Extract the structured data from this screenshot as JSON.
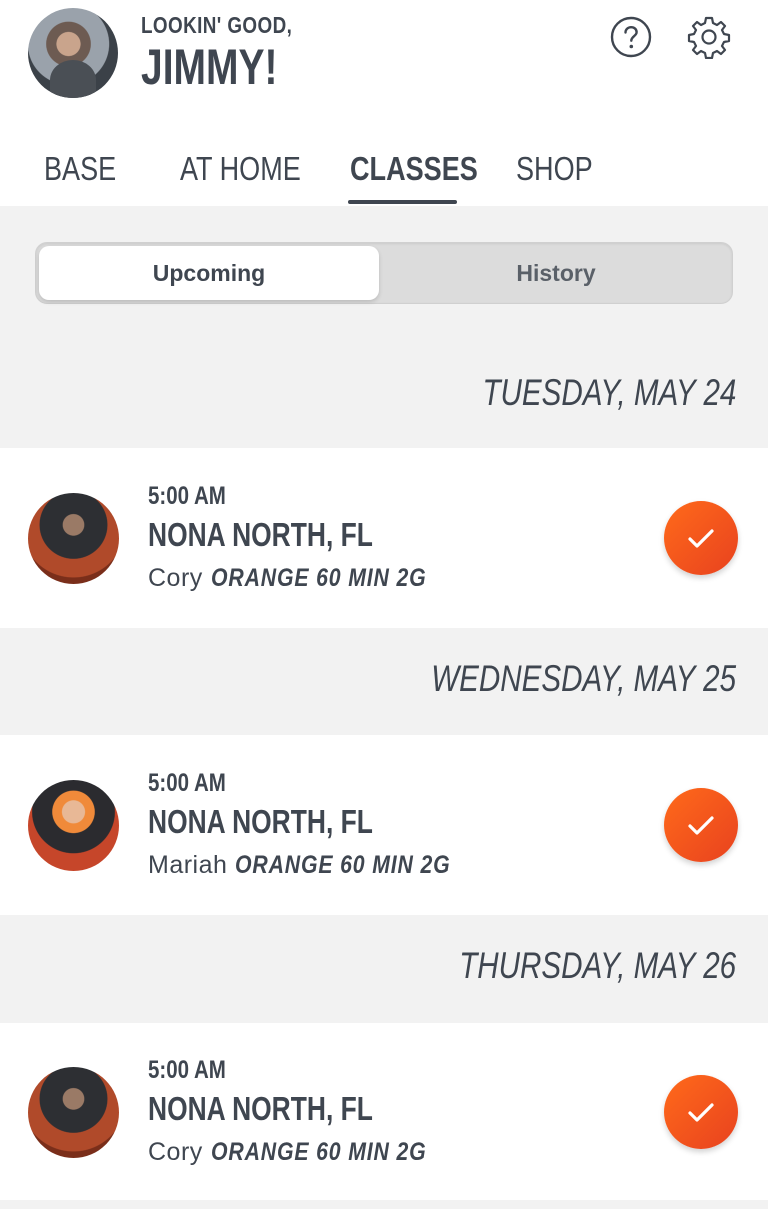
{
  "header": {
    "greeting_line1": "LOOKIN' GOOD,",
    "greeting_line2": "JIMMY!",
    "help_icon": "help-circle-icon",
    "settings_icon": "gear-icon"
  },
  "tabs": [
    {
      "label": "BASE",
      "active": false
    },
    {
      "label": "AT HOME",
      "active": false
    },
    {
      "label": "CLASSES",
      "active": true
    },
    {
      "label": "SHOP",
      "active": false
    }
  ],
  "segment": {
    "upcoming": "Upcoming",
    "history": "History",
    "selected": "Upcoming"
  },
  "days": [
    {
      "label": "TUESDAY, MAY 24",
      "classes": [
        {
          "time": "5:00 AM",
          "location": "NONA NORTH, FL",
          "coach": "Cory",
          "type": "ORANGE 60 MIN 2G",
          "booked": true
        }
      ]
    },
    {
      "label": "WEDNESDAY, MAY 25",
      "classes": [
        {
          "time": "5:00 AM",
          "location": "NONA NORTH, FL",
          "coach": "Mariah",
          "type": "ORANGE 60 MIN 2G",
          "booked": true
        }
      ]
    },
    {
      "label": "THURSDAY, MAY 26",
      "classes": [
        {
          "time": "5:00 AM",
          "location": "NONA NORTH, FL",
          "coach": "Cory",
          "type": "ORANGE 60 MIN 2G",
          "booked": true
        }
      ]
    }
  ],
  "colors": {
    "accent": "#f05a22",
    "text": "#3f4650",
    "band": "#f2f2f2"
  }
}
